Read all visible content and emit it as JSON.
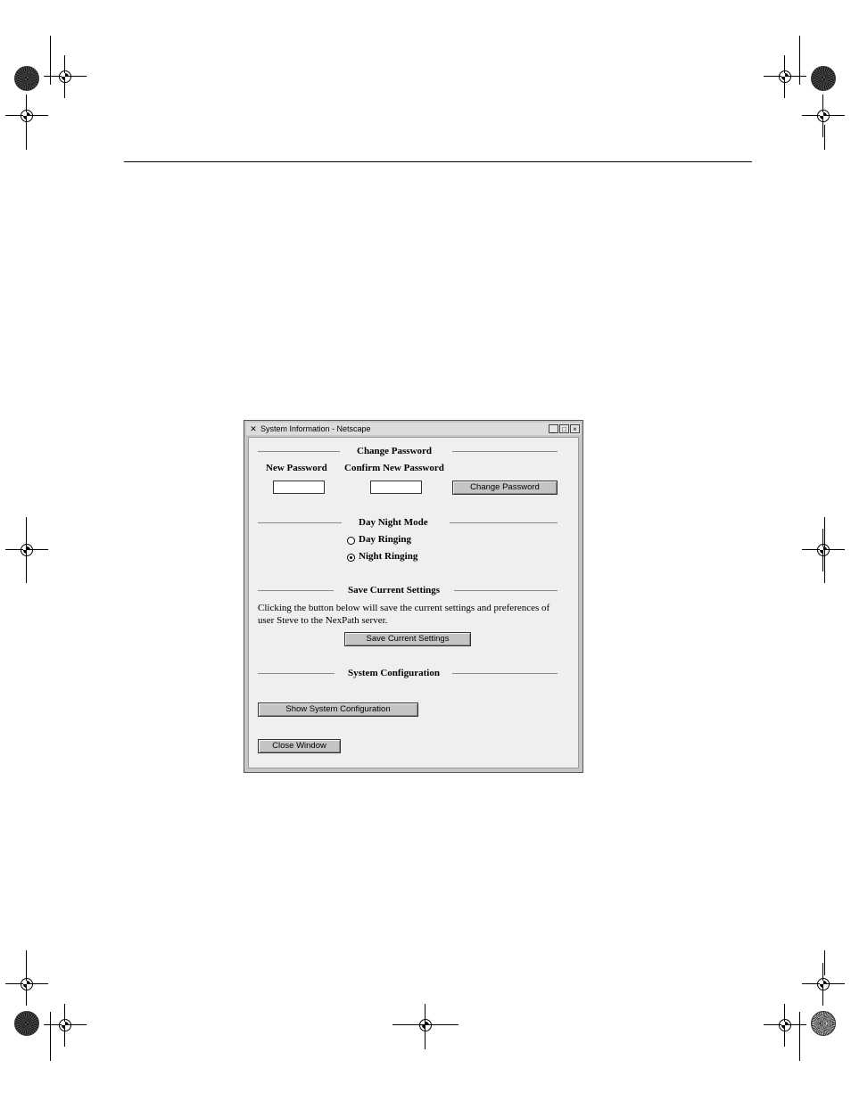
{
  "window": {
    "title": "System Information - Netscape",
    "minimize": "_",
    "maximize": "□",
    "close": "×"
  },
  "change_password": {
    "heading": "Change Password",
    "new_label": "New Password",
    "confirm_label": "Confirm New Password",
    "new_value": "",
    "confirm_value": "",
    "button": "Change Password"
  },
  "day_night": {
    "heading": "Day Night Mode",
    "options": [
      {
        "label": "Day Ringing",
        "selected": false
      },
      {
        "label": "Night Ringing",
        "selected": true
      }
    ]
  },
  "save_settings": {
    "heading": "Save Current Settings",
    "description": "Clicking the button below will save the current settings and preferences of user Steve to the NexPath server.",
    "button": "Save Current Settings"
  },
  "system_config": {
    "heading": "System Configuration",
    "button": "Show System Configuration"
  },
  "close_button": "Close Window"
}
